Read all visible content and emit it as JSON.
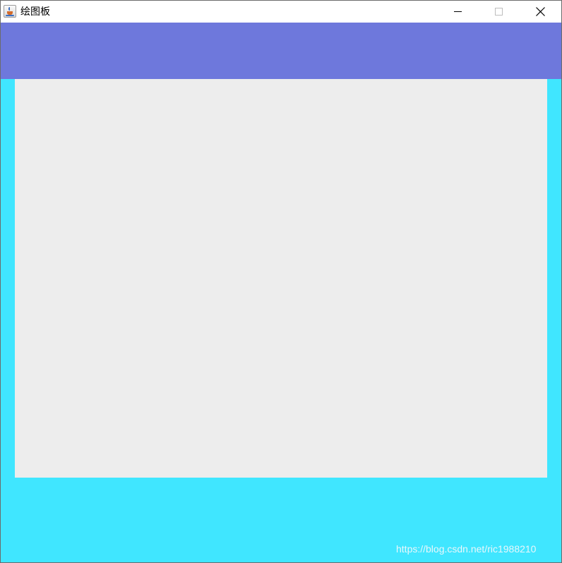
{
  "window": {
    "title": "绘图板",
    "app_icon": "java-cup-icon",
    "controls": {
      "minimize_icon": "minimize-icon",
      "maximize_icon": "maximize-icon",
      "close_icon": "close-icon"
    }
  },
  "colors": {
    "titlebar": "#ffffff",
    "toolbar_panel": "#6e78dc",
    "window_background": "#40e6ff",
    "drawing_canvas": "#ededed"
  },
  "watermark": {
    "text": "https://blog.csdn.net/ric1988210"
  }
}
